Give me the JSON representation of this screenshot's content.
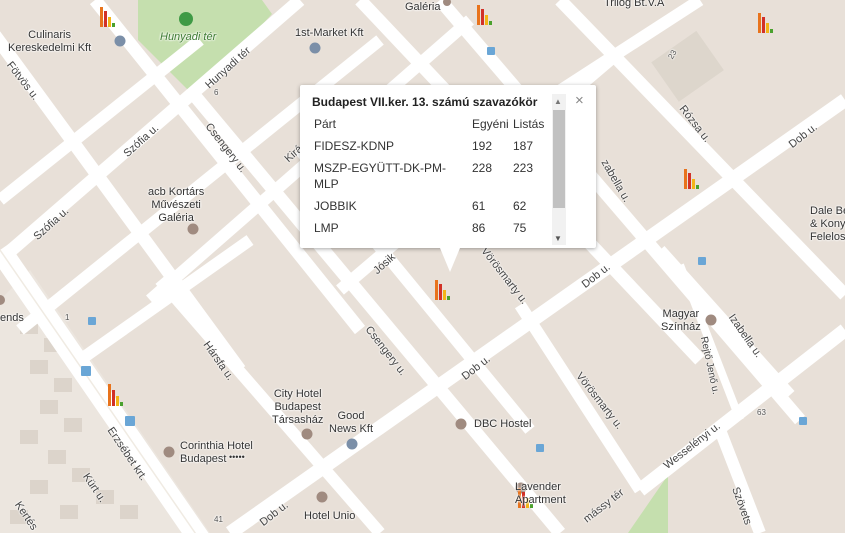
{
  "popup": {
    "title": "Budapest VII.ker. 13. számú szavazókör",
    "close_glyph": "×",
    "headers": [
      "Párt",
      "Egyéni",
      "Listás"
    ],
    "rows": [
      {
        "party": "FIDESZ-KDNP",
        "egyeni": "192",
        "listas": "187"
      },
      {
        "party": "MSZP-EGYÜTT-DK-PM-MLP",
        "egyeni": "228",
        "listas": "223"
      },
      {
        "party": "JOBBIK",
        "egyeni": "61",
        "listas": "62"
      },
      {
        "party": "LMP",
        "egyeni": "86",
        "listas": "75"
      }
    ],
    "scroll_up": "▲",
    "scroll_down": "▼"
  },
  "map": {
    "parks": {
      "hunyadi": "Hunyadi tér"
    },
    "streets": {
      "fotvos": "Fötvös u.",
      "szofia_upper": "Szófia u.",
      "szofia_lower": "Szófia u.",
      "hunyadi_ter": "Hunyadi tér",
      "csengery_upper": "Csengery u.",
      "csengery_lower": "Csengery u.",
      "kiraly": "Kirá",
      "josika": "Jósik",
      "vorosmarty_upper": "Vörösmarty u.",
      "vorosmarty_lower": "Vörösmarty u.",
      "rozsa": "Rózsa u.",
      "dob_right": "Dob u.",
      "dob_mid": "Dob u.",
      "dob_center": "Dob u.",
      "dob_lower": "Dob u.",
      "izabella_upper": "zabella u.",
      "izabella_lower": "Izabella u.",
      "harsfa": "Hársfa u.",
      "erzsebet": "Erzsébet krt.",
      "kurt": "Kürt u.",
      "kertesz": "Kertés",
      "rejto": "Rejtő Jenő u.",
      "wesselenyi": "Wesselényi u.",
      "szovetseg": "Szövets",
      "klauzal_part": "mássy tér"
    },
    "pois": {
      "culinaris": "Culinaris\nKereskedelmi Kft",
      "first_market": "1st-Market Kft",
      "galeria_top": "Galéria",
      "trilog": "Trilog Bt.V.A",
      "acb": "acb Kortárs\nMűvészeti\nGaléria",
      "dale": "Dale Be\n& Konyk\nFelelos",
      "magyar": "Magyar\nSzínház",
      "city_hotel": "City Hotel\nBudapest\nTársasház",
      "good_news": "Good\nNews Kft",
      "dbc": "DBC Hostel",
      "corinthia": "Corinthia Hotel\nBudapest",
      "corinthia_stars": "•••••",
      "lavender": "Lavender\nApartment",
      "hotel_unio": "Hotel Unio",
      "ends": "ends"
    },
    "numbers": {
      "n6": "6",
      "n1": "1",
      "n23": "23",
      "n63": "63",
      "n41": "41"
    }
  },
  "colors": {
    "bar_orange": "#e8731c",
    "bar_red": "#d23127",
    "bar_yellow": "#f3b417",
    "bar_green": "#4aa12e",
    "road": "#ffffff",
    "block": "#e8e0d8",
    "park": "#c5dfae"
  }
}
